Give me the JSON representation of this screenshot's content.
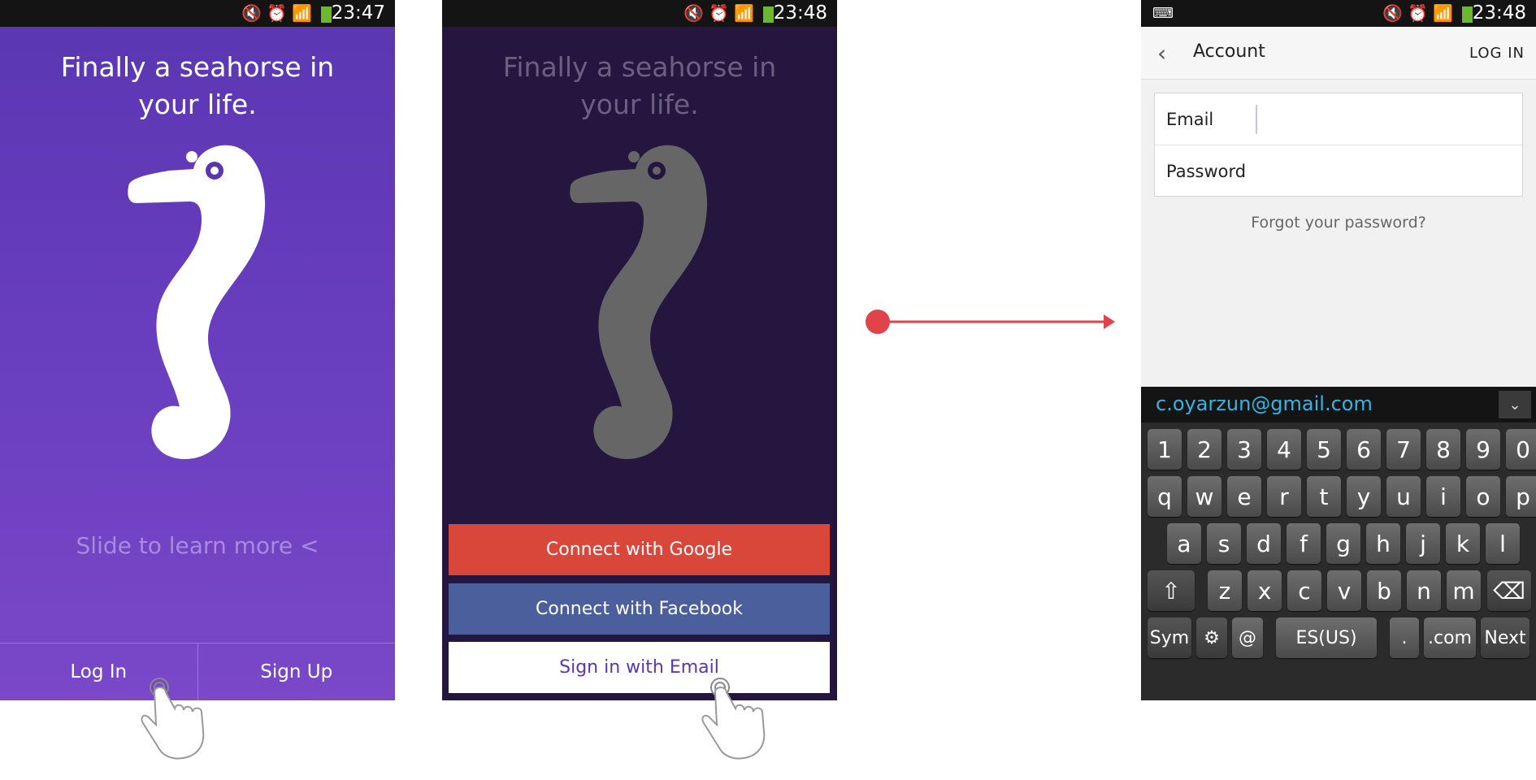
{
  "screen1": {
    "status_time": "23:47",
    "title": "Finally a seahorse in your life.",
    "slide_text": "Slide to learn more <",
    "login_button": "Log In",
    "signup_button": "Sign Up"
  },
  "screen2": {
    "status_time": "23:48",
    "title": "Finally a seahorse in your life.",
    "google_button": "Connect with Google",
    "facebook_button": "Connect with Facebook",
    "email_button": "Sign in with Email"
  },
  "screen3": {
    "status_time": "23:48",
    "appbar_title": "Account",
    "appbar_action": "LOG IN",
    "email_label": "Email",
    "password_label": "Password",
    "forgot_link": "Forgot your password?",
    "keyboard": {
      "suggestion": "c.oyarzun@gmail.com",
      "row_numbers": [
        "1",
        "2",
        "3",
        "4",
        "5",
        "6",
        "7",
        "8",
        "9",
        "0"
      ],
      "row_top": [
        "q",
        "w",
        "e",
        "r",
        "t",
        "y",
        "u",
        "i",
        "o",
        "p"
      ],
      "row_middle": [
        "a",
        "s",
        "d",
        "f",
        "g",
        "h",
        "j",
        "k",
        "l"
      ],
      "row_bottom": [
        "z",
        "x",
        "c",
        "v",
        "b",
        "n",
        "m"
      ],
      "sym_key": "Sym",
      "at_key": "@",
      "space_label": "ES(US)",
      "dot_key": ".",
      "com_key": ".com",
      "next_key": "Next"
    }
  },
  "colors": {
    "accent_purple": "#5a36b2",
    "google_red": "#d9473a",
    "facebook_blue": "#4a5f9c",
    "arrow_red": "#e0444a",
    "suggestion_blue": "#33b5e5"
  }
}
